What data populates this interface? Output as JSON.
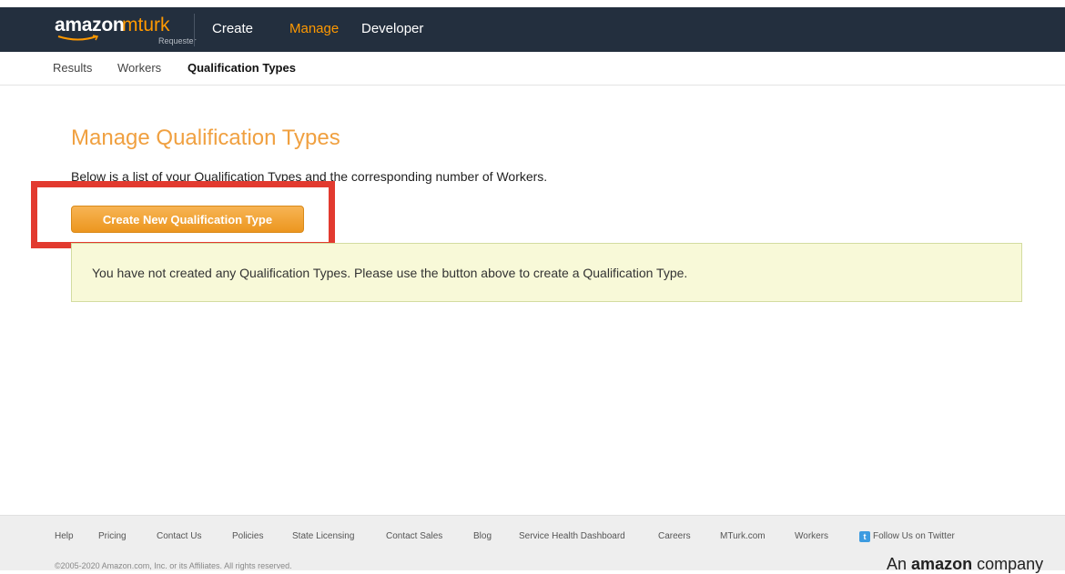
{
  "brand": {
    "amazon": "amazon",
    "mturk": "mturk",
    "sub": "Requester"
  },
  "topnav": {
    "create": "Create",
    "manage": "Manage",
    "developer": "Developer"
  },
  "subnav": {
    "results": "Results",
    "workers": "Workers",
    "qualification_types": "Qualification Types"
  },
  "main": {
    "title": "Manage Qualification Types",
    "intro": "Below is a list of your Qualification Types and the corresponding number of Workers.",
    "create_button": "Create New Qualification Type",
    "notice": "You have not created any Qualification Types. Please use the button above to create a Qualification Type."
  },
  "footer": {
    "links": [
      "Help",
      "Pricing",
      "Contact Us",
      "Policies",
      "State Licensing",
      "Contact Sales",
      "Blog",
      "Service Health Dashboard",
      "Careers",
      "MTurk.com",
      "Workers",
      "Follow Us on Twitter"
    ],
    "copyright": "©2005-2020 Amazon.com, Inc. or its Affiliates. All rights reserved.",
    "an": "An",
    "amazon": "amazon",
    "company": "company"
  },
  "colors": {
    "accent": "#ff9900",
    "topbar": "#232f3e",
    "highlight": "#e23a2f",
    "notice_bg": "#f8f9d8"
  }
}
